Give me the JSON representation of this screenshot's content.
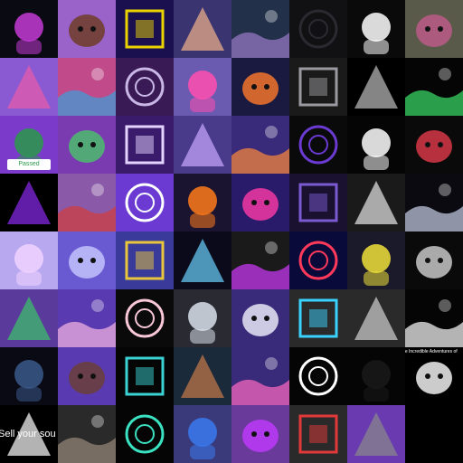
{
  "gallery": {
    "tiles": [
      {
        "icon": "astronaut-helmet-icon",
        "bg": "#0a0a12",
        "accent": "#c43ad6"
      },
      {
        "icon": "coffee-cup-icon",
        "bg": "#9a63c9",
        "accent": "#6b3a1e"
      },
      {
        "icon": "pixel-mosaic-icon",
        "bg": "#1a1050",
        "accent": "#e8d400"
      },
      {
        "icon": "pixel-character-icon",
        "bg": "#3a3470",
        "accent": "#f2b38a"
      },
      {
        "icon": "hooded-figure-icon",
        "bg": "#22304a",
        "accent": "#9b7cc9"
      },
      {
        "icon": "dark-pattern-icon",
        "bg": "#111114",
        "accent": "#2a2a30"
      },
      {
        "icon": "cartoon-boy-icon",
        "bg": "#0a0a0a",
        "accent": "#ffffff"
      },
      {
        "icon": "collage-icon",
        "bg": "#5a5a4a",
        "accent": "#c05a8a"
      },
      {
        "icon": "donut-character-icon",
        "bg": "#8a5ad2",
        "accent": "#e95aa8"
      },
      {
        "icon": "abstract-waves-icon",
        "bg": "#c04a8a",
        "accent": "#3aa0d8"
      },
      {
        "icon": "pentagram-icon",
        "bg": "#3a1a55",
        "accent": "#c9b7e6"
      },
      {
        "icon": "pixel-punk-icon",
        "bg": "#6a5ab0",
        "accent": "#ff4fb0"
      },
      {
        "icon": "boxing-ring-icon",
        "bg": "#1a1a40",
        "accent": "#ff7a2a"
      },
      {
        "icon": "doll-face-icon",
        "bg": "#1a1a1a",
        "accent": "#9a9aa0"
      },
      {
        "icon": "dotted-frame-icon",
        "bg": "#000000",
        "accent": "#bdbdbd"
      },
      {
        "icon": "glitch-silhouette-icon",
        "bg": "#050505",
        "accent": "#3adf6a"
      },
      {
        "icon": "pixel-qr-icon",
        "bg": "#7b3ac9",
        "accent": "#2a9a4a"
      },
      {
        "icon": "cat-mask-icon",
        "bg": "#7a3ab0",
        "accent": "#4ac46a"
      },
      {
        "icon": "hourglass-icon",
        "bg": "#3a1a6a",
        "accent": "#e4d2ff"
      },
      {
        "icon": "crystal-shard-icon",
        "bg": "#4a3a8a",
        "accent": "#c8a8ff"
      },
      {
        "icon": "sunset-tree-icon",
        "bg": "#3a2a7a",
        "accent": "#ff8a3a"
      },
      {
        "icon": "crowd-silhouette-icon",
        "bg": "#0a0a0a",
        "accent": "#6a3ad2"
      },
      {
        "icon": "astronaut-badge-icon",
        "bg": "#050505",
        "accent": "#ffffff"
      },
      {
        "icon": "menu-card-icon",
        "bg": "#0a0a0a",
        "accent": "#e23a4a"
      },
      {
        "icon": "neon-frame-icon",
        "bg": "#000000",
        "accent": "#8a2af0"
      },
      {
        "icon": "helmet-warrior-icon",
        "bg": "#8a5aa8",
        "accent": "#d23a3a"
      },
      {
        "icon": "open-book-icon",
        "bg": "#6a3ad2",
        "accent": "#ffffff"
      },
      {
        "icon": "moon-pumpkin-icon",
        "bg": "#1a1430",
        "accent": "#ff7a1a"
      },
      {
        "icon": "neon-city-icon",
        "bg": "#2a1a6a",
        "accent": "#ff3aa8"
      },
      {
        "icon": "purple-forest-icon",
        "bg": "#1a1030",
        "accent": "#7a5ad2"
      },
      {
        "icon": "horse-icon",
        "bg": "#1a1a1a",
        "accent": "#e8e8e8"
      },
      {
        "icon": "cube-cluster-icon",
        "bg": "#0a0a10",
        "accent": "#c8d0e8"
      },
      {
        "icon": "cube-robot-icon",
        "bg": "#b8a8f0",
        "accent": "#f0d2ff"
      },
      {
        "icon": "cosmic-cloud-icon",
        "bg": "#6a5ad2",
        "accent": "#c8c8ff"
      },
      {
        "icon": "flower-head-icon",
        "bg": "#3a3a9a",
        "accent": "#e8c83a"
      },
      {
        "icon": "lightning-figure-icon",
        "bg": "#0a0a1a",
        "accent": "#6ad2ff"
      },
      {
        "icon": "samurai-circle-icon",
        "bg": "#1a1a1a",
        "accent": "#d23aff"
      },
      {
        "icon": "eye-portal-icon",
        "bg": "#0a0a3a",
        "accent": "#ff3a5a"
      },
      {
        "icon": "jersey-figure-icon",
        "bg": "#1a1a2a",
        "accent": "#f2e23a"
      },
      {
        "icon": "poster-card-icon",
        "bg": "#0a0a0a",
        "accent": "#d2d2d2"
      },
      {
        "icon": "diamond-sticker-icon",
        "bg": "#5a3a9a",
        "accent": "#3ac46a"
      },
      {
        "icon": "jellyfish-icon",
        "bg": "#5a3ab0",
        "accent": "#f7b6e2"
      },
      {
        "icon": "cute-face-icon",
        "bg": "#0a0a0a",
        "accent": "#f8c8d8"
      },
      {
        "icon": "glass-bow-icon",
        "bg": "#2a2a32",
        "accent": "#d8e0ea"
      },
      {
        "icon": "egg-icon",
        "bg": "#3a2a7a",
        "accent": "#f2f2ff"
      },
      {
        "icon": "neon-square-icon",
        "bg": "#2a2a2a",
        "accent": "#3ad2ff"
      },
      {
        "icon": "glass-cube-icon",
        "bg": "#2a2a2a",
        "accent": "#d2d2d2"
      },
      {
        "icon": "spiral-icon",
        "bg": "#050505",
        "accent": "#ffffff"
      },
      {
        "icon": "dark-room-icon",
        "bg": "#0a0a14",
        "accent": "#3a5a8a"
      },
      {
        "icon": "bald-avatar-icon",
        "bg": "#5a3ab0",
        "accent": "#6a4030"
      },
      {
        "icon": "orbit-ring-icon",
        "bg": "#050505",
        "accent": "#3ad2d2"
      },
      {
        "icon": "warrior-woman-icon",
        "bg": "#1a2a3a",
        "accent": "#c87a4a"
      },
      {
        "icon": "unicorn-icon",
        "bg": "#3a2a7a",
        "accent": "#ff6ac2"
      },
      {
        "icon": "ghost-dancer-icon",
        "bg": "#050505",
        "accent": "#ffffff"
      },
      {
        "icon": "ink-brush-icon",
        "bg": "#050505",
        "accent": "#1a1a1a"
      },
      {
        "icon": "title-card-icon",
        "bg": "#000000",
        "accent": "#ffffff"
      },
      {
        "icon": "text-banner-icon",
        "bg": "#000000",
        "accent": "#ffffff"
      },
      {
        "icon": "portrait-photo-icon",
        "bg": "#2a2a2a",
        "accent": "#9a8a7a"
      },
      {
        "icon": "neon-tree-icon",
        "bg": "#050505",
        "accent": "#3ae2c2"
      },
      {
        "icon": "anime-hero-icon",
        "bg": "#3a3a7a",
        "accent": "#3a7af0"
      },
      {
        "icon": "anime-girl-icon",
        "bg": "#6a3a9a",
        "accent": "#c23aff"
      },
      {
        "icon": "cosplay-girl-icon",
        "bg": "#2a2a2a",
        "accent": "#e23a3a"
      },
      {
        "icon": "cartridge-icon",
        "bg": "#6a3ab0",
        "accent": "#8a8a8a"
      }
    ],
    "labels": {
      "passed": "Passed",
      "incredible": "The Incredible Adventures of",
      "sell": "Sell your sou"
    }
  }
}
